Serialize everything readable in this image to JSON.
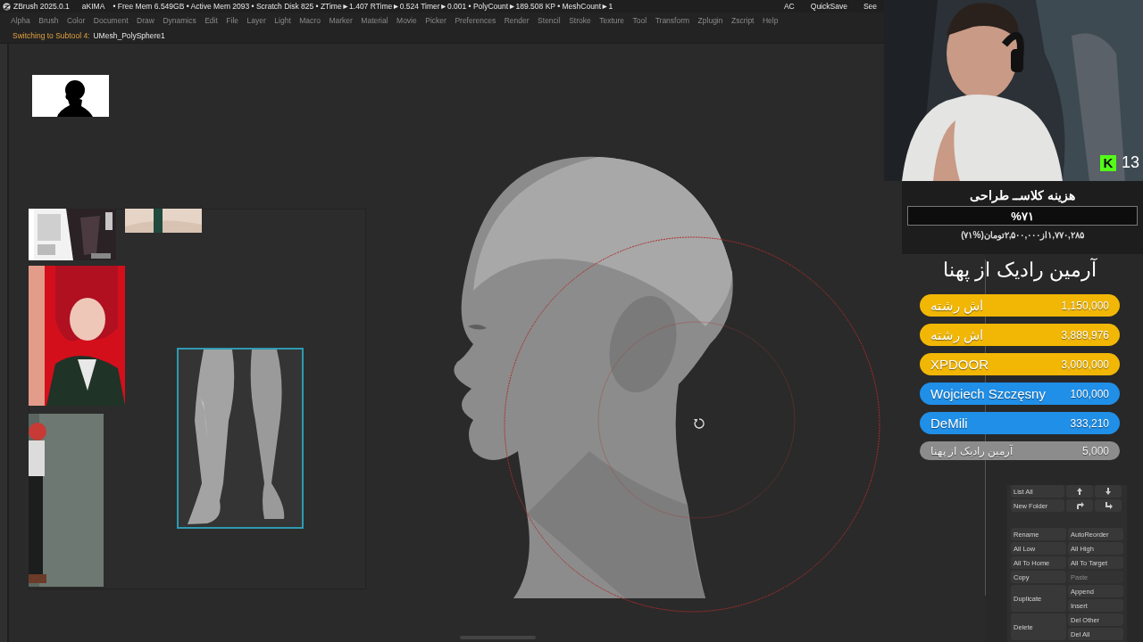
{
  "title_bar": {
    "app": "ZBrush 2025.0.1",
    "user": "aKIMA",
    "stats": "• Free Mem 6.549GB • Active Mem 2093 • Scratch Disk 825 • ZTime►1.407 RTime►0.524 Timer►0.001 • PolyCount►189.508 KP • MeshCount►1",
    "actions": [
      "AC",
      "QuickSave",
      "See"
    ]
  },
  "menu": [
    "Alpha",
    "Brush",
    "Color",
    "Document",
    "Draw",
    "Dynamics",
    "Edit",
    "File",
    "Layer",
    "Light",
    "Macro",
    "Marker",
    "Material",
    "Movie",
    "Picker",
    "Preferences",
    "Render",
    "Stencil",
    "Stroke",
    "Texture",
    "Tool",
    "Transform",
    "Zplugin",
    "Zscript",
    "Help"
  ],
  "notice": {
    "label": "Switching to Subtool 4:",
    "value": "UMesh_PolySphere1"
  },
  "webcam": {
    "logo": "K",
    "count": "13"
  },
  "goal": {
    "title": "هزینه کلاســ طراحی",
    "percent": "%۷۱",
    "amount": "۱,۷۷۰,۲۸۵از۲,۵۰۰,۰۰۰تومان(%۷۱)"
  },
  "donations": {
    "title": "آرمین رادیک از پهنا",
    "items": [
      {
        "name": "اش رشته",
        "amount": "1,150,000",
        "color": "#f2b705"
      },
      {
        "name": "اش رشته",
        "amount": "3,889,976",
        "color": "#f2b705"
      },
      {
        "name": "XPDOOR",
        "amount": "3,000,000",
        "color": "#f2b705"
      },
      {
        "name": "Wojciech Szczęsny",
        "amount": "100,000",
        "color": "#1f8fe8"
      },
      {
        "name": "DeMili",
        "amount": "333,210",
        "color": "#1f8fe8"
      },
      {
        "name": "آرمین رادیک از پهنا",
        "amount": "5,000",
        "color": "#8c8c8c"
      }
    ]
  },
  "subtool_buttons": [
    {
      "kind": "row",
      "items": [
        {
          "label": "List All"
        },
        {
          "kind": "icon"
        },
        {
          "kind": "icon"
        }
      ]
    },
    {
      "kind": "row",
      "items": [
        {
          "label": "New Folder"
        },
        {
          "kind": "icon"
        },
        {
          "kind": "icon"
        }
      ]
    },
    {
      "kind": "gap"
    },
    {
      "kind": "row",
      "items": [
        {
          "label": "Rename"
        },
        {
          "label": "AutoReorder"
        }
      ]
    },
    {
      "kind": "row",
      "items": [
        {
          "label": "All Low"
        },
        {
          "label": "All High"
        }
      ]
    },
    {
      "kind": "row",
      "items": [
        {
          "label": "All To Home"
        },
        {
          "label": "All To Target"
        }
      ]
    },
    {
      "kind": "row",
      "items": [
        {
          "label": "Copy"
        },
        {
          "label": "Paste",
          "disabled": true
        }
      ]
    },
    {
      "kind": "split",
      "items": [
        {
          "label": "Duplicate"
        },
        {
          "label": "Append"
        },
        {
          "label": "Insert"
        }
      ]
    },
    {
      "kind": "split",
      "items": [
        {
          "label": "Delete"
        },
        {
          "label": "Del Other"
        },
        {
          "label": "Del All"
        }
      ]
    }
  ]
}
